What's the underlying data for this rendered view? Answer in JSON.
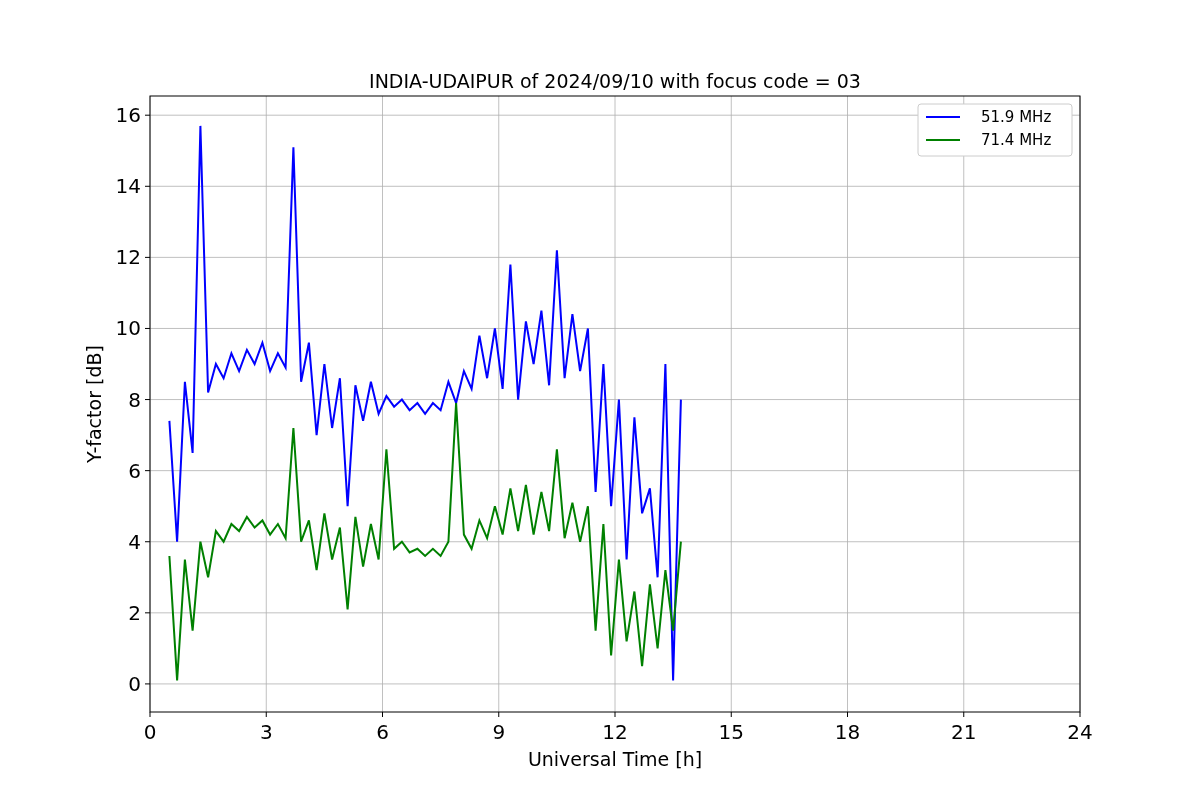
{
  "figure": {
    "chart_data": {
      "type": "line",
      "title": "INDIA-UDAIPUR of 2024/09/10 with focus code = 03",
      "xlabel": "Universal Time [h]",
      "ylabel": "Y-factor [dB]",
      "x": [
        0.5,
        0.7,
        0.9,
        1.1,
        1.3,
        1.5,
        1.7,
        1.9,
        2.1,
        2.3,
        2.5,
        2.7,
        2.9,
        3.1,
        3.3,
        3.5,
        3.7,
        3.9,
        4.1,
        4.3,
        4.5,
        4.7,
        4.9,
        5.1,
        5.3,
        5.5,
        5.7,
        5.9,
        6.1,
        6.3,
        6.5,
        6.7,
        6.9,
        7.1,
        7.3,
        7.5,
        7.7,
        7.9,
        8.1,
        8.3,
        8.5,
        8.7,
        8.9,
        9.1,
        9.3,
        9.5,
        9.7,
        9.9,
        10.1,
        10.3,
        10.5,
        10.7,
        10.9,
        11.1,
        11.3,
        11.5,
        11.7,
        11.9,
        12.1,
        12.3,
        12.5,
        12.7,
        12.9,
        13.1,
        13.3,
        13.5,
        13.7
      ],
      "series": [
        {
          "name": "51.9 MHz",
          "color": "#0000ff",
          "values": [
            7.4,
            4.0,
            8.5,
            6.5,
            15.7,
            8.2,
            9.0,
            8.6,
            9.3,
            8.8,
            9.4,
            9.0,
            9.6,
            8.8,
            9.3,
            8.9,
            15.1,
            8.5,
            9.6,
            7.0,
            9.0,
            7.2,
            8.6,
            5.0,
            8.4,
            7.4,
            8.5,
            7.6,
            8.1,
            7.8,
            8.0,
            7.7,
            7.9,
            7.6,
            7.9,
            7.7,
            8.5,
            7.9,
            8.8,
            8.3,
            9.8,
            8.6,
            10.0,
            8.3,
            11.8,
            8.0,
            10.2,
            9.0,
            10.5,
            8.4,
            12.2,
            8.6,
            10.4,
            8.8,
            10.0,
            5.4,
            9.0,
            5.0,
            8.0,
            3.5,
            7.5,
            4.8,
            5.5,
            3.0,
            9.0,
            0.1,
            8.0
          ]
        },
        {
          "name": "71.4 MHz",
          "color": "#008000",
          "values": [
            3.6,
            0.1,
            3.5,
            1.5,
            4.0,
            3.0,
            4.3,
            4.0,
            4.5,
            4.3,
            4.7,
            4.4,
            4.6,
            4.2,
            4.5,
            4.1,
            7.2,
            4.0,
            4.6,
            3.2,
            4.8,
            3.5,
            4.4,
            2.1,
            4.7,
            3.3,
            4.5,
            3.5,
            6.6,
            3.8,
            4.0,
            3.7,
            3.8,
            3.6,
            3.8,
            3.6,
            4.0,
            7.9,
            4.2,
            3.8,
            4.6,
            4.1,
            5.0,
            4.2,
            5.5,
            4.3,
            5.6,
            4.2,
            5.4,
            4.3,
            6.6,
            4.1,
            5.1,
            4.0,
            5.0,
            1.5,
            4.5,
            0.8,
            3.5,
            1.2,
            2.6,
            0.5,
            2.8,
            1.0,
            3.2,
            1.5,
            4.0
          ]
        }
      ],
      "grid": true,
      "legend": true,
      "xlim": [
        0,
        24
      ],
      "ylim": [
        -0.79,
        16.54
      ],
      "xticks": [
        0,
        3,
        6,
        9,
        12,
        15,
        18,
        21,
        24
      ],
      "yticks": [
        0,
        2,
        4,
        6,
        8,
        10,
        12,
        14,
        16
      ]
    }
  }
}
